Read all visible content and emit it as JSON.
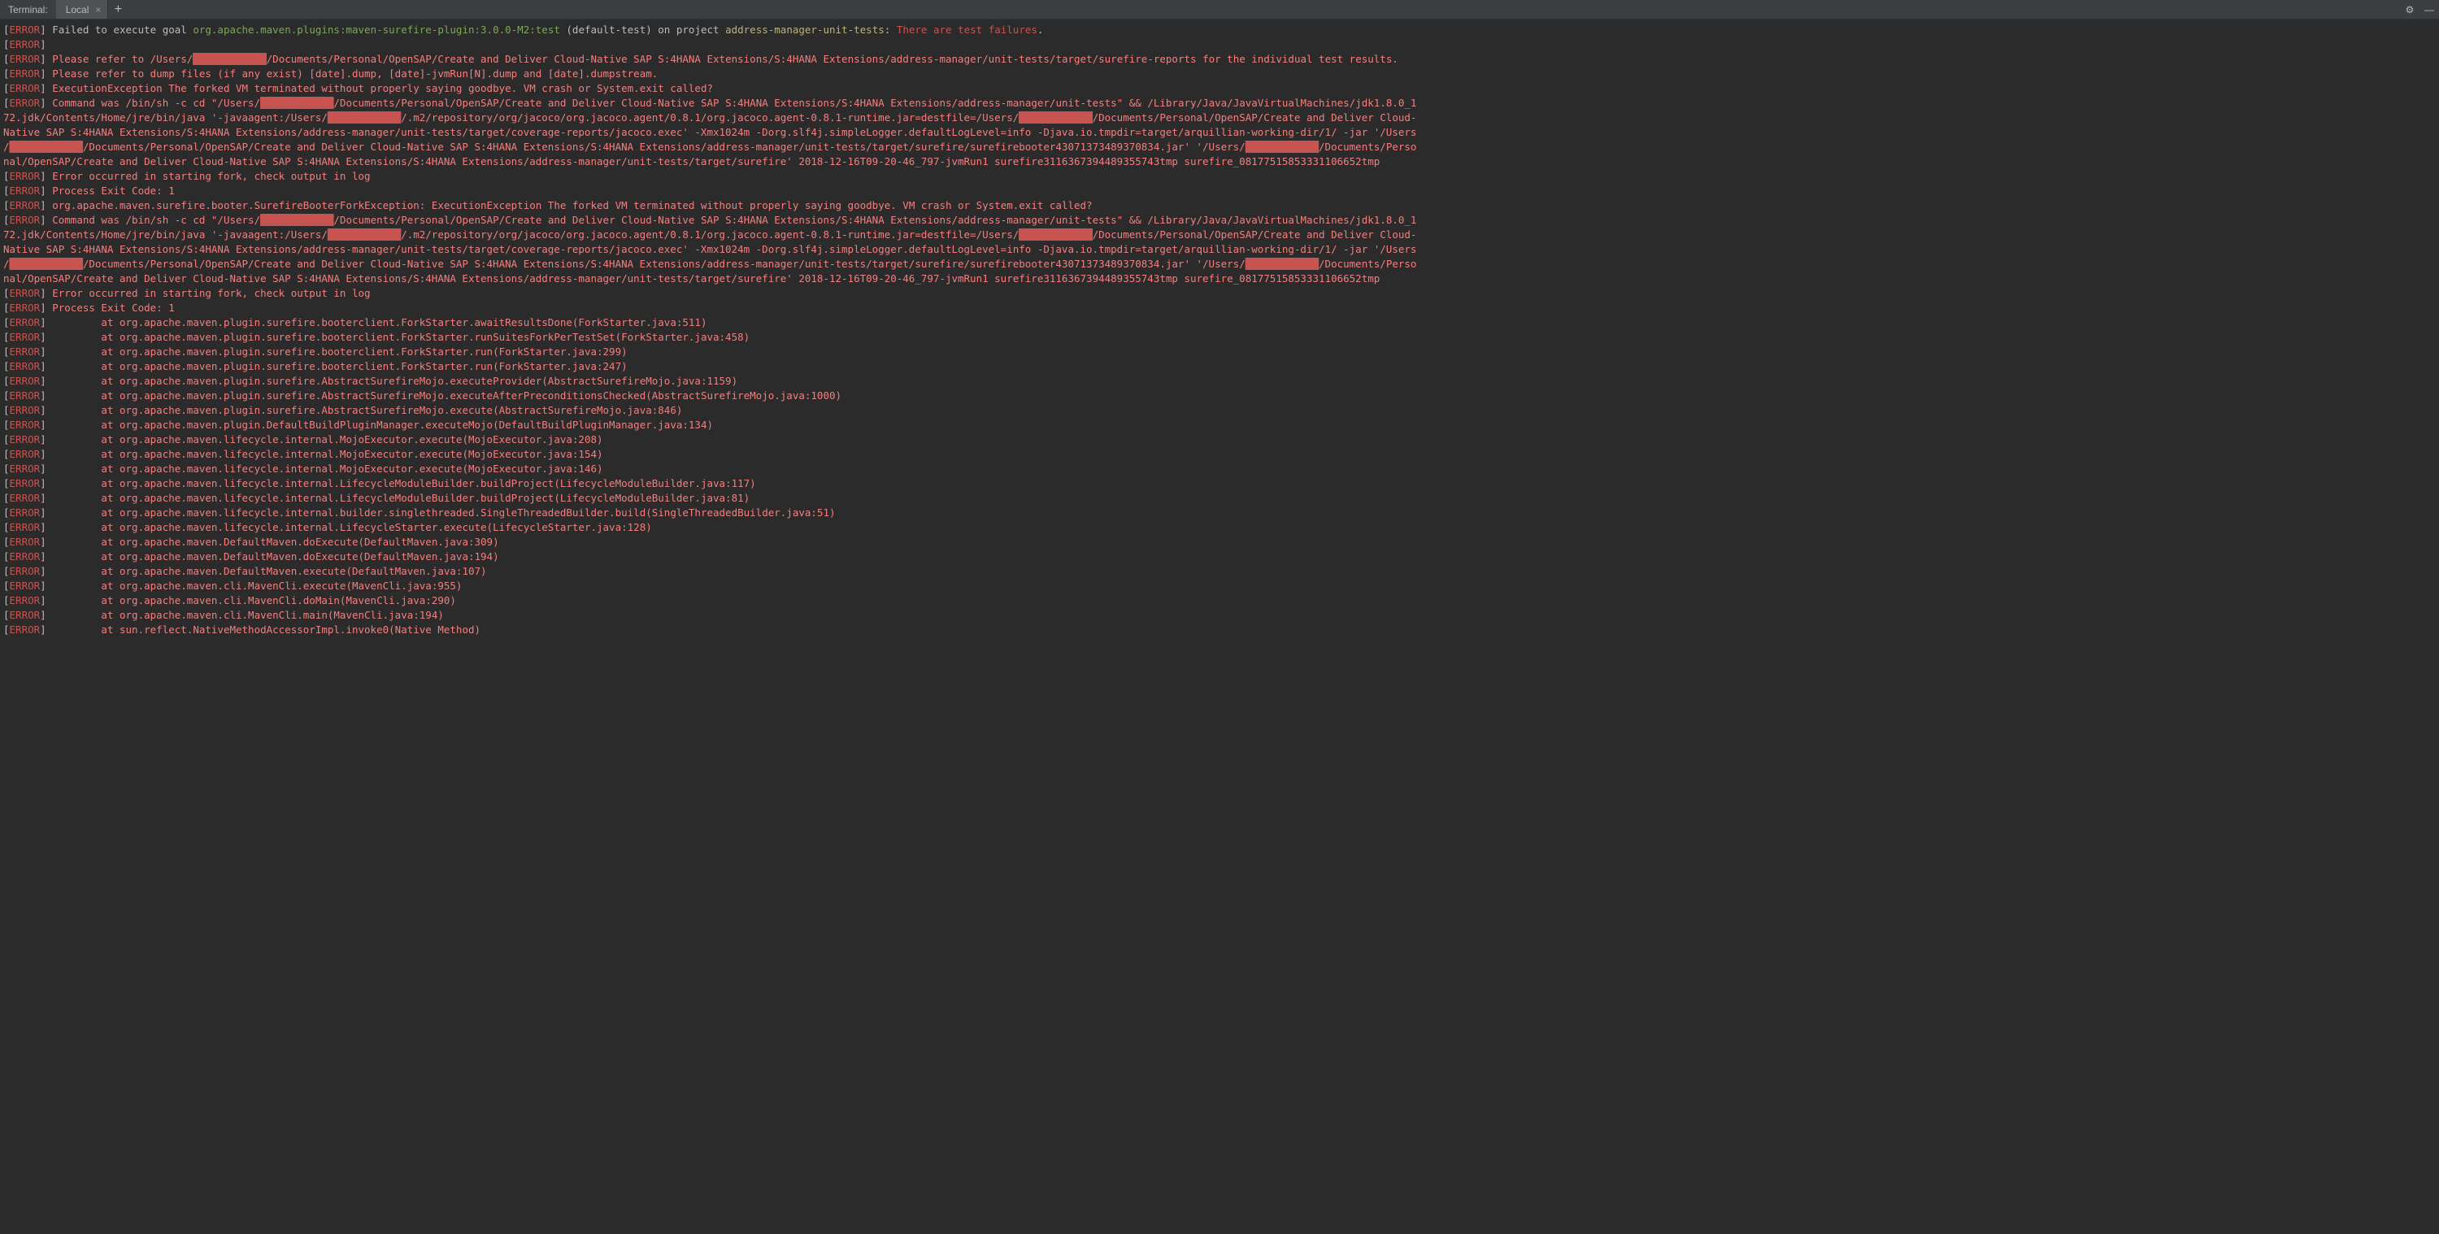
{
  "tabbar": {
    "title": "Terminal:",
    "active_tab": "Local",
    "close_glyph": "×",
    "add_glyph": "+",
    "gear_glyph": "⚙",
    "minimize_glyph": "—"
  },
  "tokens": {
    "error_label": "ERROR",
    "bracket_l": "[",
    "bracket_r": "]",
    "redacted": "████████████"
  },
  "lines": [
    {
      "type": "l1",
      "parts": [
        {
          "cls": "white",
          "text": " Failed to execute goal "
        },
        {
          "cls": "green",
          "text": "org.apache.maven.plugins:maven-surefire-plugin:3.0.0-M2:test"
        },
        {
          "cls": "white",
          "text": " (default-test) on project "
        },
        {
          "cls": "yellow",
          "text": "address-manager-unit-tests"
        },
        {
          "cls": "white",
          "text": ": "
        },
        {
          "cls": "red",
          "text": "There are test failures"
        },
        {
          "cls": "white",
          "text": "."
        }
      ]
    },
    {
      "type": "err",
      "parts": []
    },
    {
      "type": "err",
      "parts": [
        {
          "cls": "salmon",
          "text": " Please refer to /Users/"
        },
        {
          "cls": "redact",
          "text": "████████████"
        },
        {
          "cls": "salmon",
          "text": "/Documents/Personal/OpenSAP/Create and Deliver Cloud-Native SAP S:4HANA Extensions/S:4HANA Extensions/address-manager/unit-tests/target/surefire-reports for the individual test results."
        }
      ]
    },
    {
      "type": "err",
      "parts": [
        {
          "cls": "salmon",
          "text": " Please refer to dump files (if any exist) [date].dump, [date]-jvmRun[N].dump and [date].dumpstream."
        }
      ]
    },
    {
      "type": "err",
      "parts": [
        {
          "cls": "salmon",
          "text": " ExecutionException The forked VM terminated without properly saying goodbye. VM crash or System.exit called?"
        }
      ]
    },
    {
      "type": "err",
      "parts": [
        {
          "cls": "salmon",
          "text": " Command was /bin/sh -c cd \"/Users/"
        },
        {
          "cls": "redact",
          "text": "████████████"
        },
        {
          "cls": "salmon",
          "text": "/Documents/Personal/OpenSAP/Create and Deliver Cloud-Native SAP S:4HANA Extensions/S:4HANA Extensions/address-manager/unit-tests\" && /Library/Java/JavaVirtualMachines/jdk1.8.0_1"
        }
      ]
    },
    {
      "type": "cont",
      "parts": [
        {
          "cls": "salmon",
          "text": "72.jdk/Contents/Home/jre/bin/java '-javaagent:/Users/"
        },
        {
          "cls": "redact",
          "text": "████████████"
        },
        {
          "cls": "salmon",
          "text": "/.m2/repository/org/jacoco/org.jacoco.agent/0.8.1/org.jacoco.agent-0.8.1-runtime.jar=destfile=/Users/"
        },
        {
          "cls": "redact",
          "text": "████████████"
        },
        {
          "cls": "salmon",
          "text": "/Documents/Personal/OpenSAP/Create and Deliver Cloud-"
        }
      ]
    },
    {
      "type": "cont",
      "parts": [
        {
          "cls": "salmon",
          "text": "Native SAP S:4HANA Extensions/S:4HANA Extensions/address-manager/unit-tests/target/coverage-reports/jacoco.exec' -Xmx1024m -Dorg.slf4j.simpleLogger.defaultLogLevel=info -Djava.io.tmpdir=target/arquillian-working-dir/1/ -jar '/Users"
        }
      ]
    },
    {
      "type": "cont",
      "parts": [
        {
          "cls": "salmon",
          "text": "/"
        },
        {
          "cls": "redact",
          "text": "████████████"
        },
        {
          "cls": "salmon",
          "text": "/Documents/Personal/OpenSAP/Create and Deliver Cloud-Native SAP S:4HANA Extensions/S:4HANA Extensions/address-manager/unit-tests/target/surefire/surefirebooter43071373489370834.jar' '/Users/"
        },
        {
          "cls": "redact",
          "text": "████████████"
        },
        {
          "cls": "salmon",
          "text": "/Documents/Perso"
        }
      ]
    },
    {
      "type": "cont",
      "parts": [
        {
          "cls": "salmon",
          "text": "nal/OpenSAP/Create and Deliver Cloud-Native SAP S:4HANA Extensions/S:4HANA Extensions/address-manager/unit-tests/target/surefire' 2018-12-16T09-20-46_797-jvmRun1 surefire3116367394489355743tmp surefire_08177515853331106652tmp"
        }
      ]
    },
    {
      "type": "err",
      "parts": [
        {
          "cls": "salmon",
          "text": " Error occurred in starting fork, check output in log"
        }
      ]
    },
    {
      "type": "err",
      "parts": [
        {
          "cls": "salmon",
          "text": " Process Exit Code: 1"
        }
      ]
    },
    {
      "type": "err",
      "parts": [
        {
          "cls": "salmon",
          "text": " org.apache.maven.surefire.booter.SurefireBooterForkException: ExecutionException The forked VM terminated without properly saying goodbye. VM crash or System.exit called?"
        }
      ]
    },
    {
      "type": "err",
      "parts": [
        {
          "cls": "salmon",
          "text": " Command was /bin/sh -c cd \"/Users/"
        },
        {
          "cls": "redact",
          "text": "████████████"
        },
        {
          "cls": "salmon",
          "text": "/Documents/Personal/OpenSAP/Create and Deliver Cloud-Native SAP S:4HANA Extensions/S:4HANA Extensions/address-manager/unit-tests\" && /Library/Java/JavaVirtualMachines/jdk1.8.0_1"
        }
      ]
    },
    {
      "type": "cont",
      "parts": [
        {
          "cls": "salmon",
          "text": "72.jdk/Contents/Home/jre/bin/java '-javaagent:/Users/"
        },
        {
          "cls": "redact",
          "text": "████████████"
        },
        {
          "cls": "salmon",
          "text": "/.m2/repository/org/jacoco/org.jacoco.agent/0.8.1/org.jacoco.agent-0.8.1-runtime.jar=destfile=/Users/"
        },
        {
          "cls": "redact",
          "text": "████████████"
        },
        {
          "cls": "salmon",
          "text": "/Documents/Personal/OpenSAP/Create and Deliver Cloud-"
        }
      ]
    },
    {
      "type": "cont",
      "parts": [
        {
          "cls": "salmon",
          "text": "Native SAP S:4HANA Extensions/S:4HANA Extensions/address-manager/unit-tests/target/coverage-reports/jacoco.exec' -Xmx1024m -Dorg.slf4j.simpleLogger.defaultLogLevel=info -Djava.io.tmpdir=target/arquillian-working-dir/1/ -jar '/Users"
        }
      ]
    },
    {
      "type": "cont",
      "parts": [
        {
          "cls": "salmon",
          "text": "/"
        },
        {
          "cls": "redact",
          "text": "████████████"
        },
        {
          "cls": "salmon",
          "text": "/Documents/Personal/OpenSAP/Create and Deliver Cloud-Native SAP S:4HANA Extensions/S:4HANA Extensions/address-manager/unit-tests/target/surefire/surefirebooter43071373489370834.jar' '/Users/"
        },
        {
          "cls": "redact",
          "text": "████████████"
        },
        {
          "cls": "salmon",
          "text": "/Documents/Perso"
        }
      ]
    },
    {
      "type": "cont",
      "parts": [
        {
          "cls": "salmon",
          "text": "nal/OpenSAP/Create and Deliver Cloud-Native SAP S:4HANA Extensions/S:4HANA Extensions/address-manager/unit-tests/target/surefire' 2018-12-16T09-20-46_797-jvmRun1 surefire3116367394489355743tmp surefire_08177515853331106652tmp"
        }
      ]
    },
    {
      "type": "err",
      "parts": [
        {
          "cls": "salmon",
          "text": " Error occurred in starting fork, check output in log"
        }
      ]
    },
    {
      "type": "err",
      "parts": [
        {
          "cls": "salmon",
          "text": " Process Exit Code: 1"
        }
      ]
    },
    {
      "type": "err",
      "parts": [
        {
          "cls": "salmon",
          "text": "         at org.apache.maven.plugin.surefire.booterclient.ForkStarter.awaitResultsDone(ForkStarter.java:511)"
        }
      ]
    },
    {
      "type": "err",
      "parts": [
        {
          "cls": "salmon",
          "text": "         at org.apache.maven.plugin.surefire.booterclient.ForkStarter.runSuitesForkPerTestSet(ForkStarter.java:458)"
        }
      ]
    },
    {
      "type": "err",
      "parts": [
        {
          "cls": "salmon",
          "text": "         at org.apache.maven.plugin.surefire.booterclient.ForkStarter.run(ForkStarter.java:299)"
        }
      ]
    },
    {
      "type": "err",
      "parts": [
        {
          "cls": "salmon",
          "text": "         at org.apache.maven.plugin.surefire.booterclient.ForkStarter.run(ForkStarter.java:247)"
        }
      ]
    },
    {
      "type": "err",
      "parts": [
        {
          "cls": "salmon",
          "text": "         at org.apache.maven.plugin.surefire.AbstractSurefireMojo.executeProvider(AbstractSurefireMojo.java:1159)"
        }
      ]
    },
    {
      "type": "err",
      "parts": [
        {
          "cls": "salmon",
          "text": "         at org.apache.maven.plugin.surefire.AbstractSurefireMojo.executeAfterPreconditionsChecked(AbstractSurefireMojo.java:1000)"
        }
      ]
    },
    {
      "type": "err",
      "parts": [
        {
          "cls": "salmon",
          "text": "         at org.apache.maven.plugin.surefire.AbstractSurefireMojo.execute(AbstractSurefireMojo.java:846)"
        }
      ]
    },
    {
      "type": "err",
      "parts": [
        {
          "cls": "salmon",
          "text": "         at org.apache.maven.plugin.DefaultBuildPluginManager.executeMojo(DefaultBuildPluginManager.java:134)"
        }
      ]
    },
    {
      "type": "err",
      "parts": [
        {
          "cls": "salmon",
          "text": "         at org.apache.maven.lifecycle.internal.MojoExecutor.execute(MojoExecutor.java:208)"
        }
      ]
    },
    {
      "type": "err",
      "parts": [
        {
          "cls": "salmon",
          "text": "         at org.apache.maven.lifecycle.internal.MojoExecutor.execute(MojoExecutor.java:154)"
        }
      ]
    },
    {
      "type": "err",
      "parts": [
        {
          "cls": "salmon",
          "text": "         at org.apache.maven.lifecycle.internal.MojoExecutor.execute(MojoExecutor.java:146)"
        }
      ]
    },
    {
      "type": "err",
      "parts": [
        {
          "cls": "salmon",
          "text": "         at org.apache.maven.lifecycle.internal.LifecycleModuleBuilder.buildProject(LifecycleModuleBuilder.java:117)"
        }
      ]
    },
    {
      "type": "err",
      "parts": [
        {
          "cls": "salmon",
          "text": "         at org.apache.maven.lifecycle.internal.LifecycleModuleBuilder.buildProject(LifecycleModuleBuilder.java:81)"
        }
      ]
    },
    {
      "type": "err",
      "parts": [
        {
          "cls": "salmon",
          "text": "         at org.apache.maven.lifecycle.internal.builder.singlethreaded.SingleThreadedBuilder.build(SingleThreadedBuilder.java:51)"
        }
      ]
    },
    {
      "type": "err",
      "parts": [
        {
          "cls": "salmon",
          "text": "         at org.apache.maven.lifecycle.internal.LifecycleStarter.execute(LifecycleStarter.java:128)"
        }
      ]
    },
    {
      "type": "err",
      "parts": [
        {
          "cls": "salmon",
          "text": "         at org.apache.maven.DefaultMaven.doExecute(DefaultMaven.java:309)"
        }
      ]
    },
    {
      "type": "err",
      "parts": [
        {
          "cls": "salmon",
          "text": "         at org.apache.maven.DefaultMaven.doExecute(DefaultMaven.java:194)"
        }
      ]
    },
    {
      "type": "err",
      "parts": [
        {
          "cls": "salmon",
          "text": "         at org.apache.maven.DefaultMaven.execute(DefaultMaven.java:107)"
        }
      ]
    },
    {
      "type": "err",
      "parts": [
        {
          "cls": "salmon",
          "text": "         at org.apache.maven.cli.MavenCli.execute(MavenCli.java:955)"
        }
      ]
    },
    {
      "type": "err",
      "parts": [
        {
          "cls": "salmon",
          "text": "         at org.apache.maven.cli.MavenCli.doMain(MavenCli.java:290)"
        }
      ]
    },
    {
      "type": "err",
      "parts": [
        {
          "cls": "salmon",
          "text": "         at org.apache.maven.cli.MavenCli.main(MavenCli.java:194)"
        }
      ]
    },
    {
      "type": "err",
      "parts": [
        {
          "cls": "salmon",
          "text": "         at sun.reflect.NativeMethodAccessorImpl.invoke0(Native Method)"
        }
      ]
    }
  ]
}
